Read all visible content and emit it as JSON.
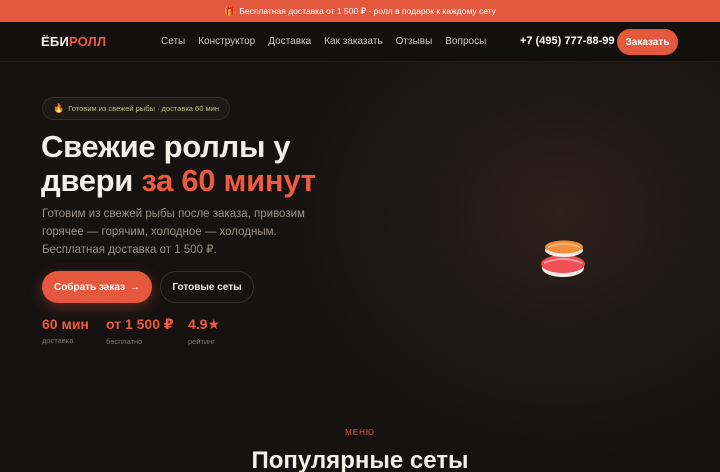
{
  "promo": {
    "icon": "gift-icon",
    "text": "Бесплатная доставка от 1 500 ₽ · ролл в подарок к каждому сету"
  },
  "header": {
    "logo_part1": "ЁБИ",
    "logo_part2": "РОЛЛ",
    "nav": [
      "Сеты",
      "Конструктор",
      "Доставка",
      "Как заказать",
      "Отзывы",
      "Вопросы"
    ],
    "phone": "+7 (495) 777-88-99",
    "order_label": "Заказать"
  },
  "hero": {
    "badge_icon": "fire-icon",
    "badge_text": "Готовим из свежей рыбы · доставка 60 мин",
    "title_line1": "Свежие роллы у",
    "title_line2_plain": "двери ",
    "title_line2_accent": "за 60 минут",
    "description": "Готовим из свежей рыбы после заказа, привозим горячее — горячим, холодное — холодным. Бесплатная доставка от 1 500 ₽.",
    "primary_button": "Собрать заказ",
    "primary_button_arrow": "→",
    "secondary_button": "Готовые сеты",
    "stats": [
      {
        "value": "60 мин",
        "label": "доставка"
      },
      {
        "value": "от 1 500 ₽",
        "label": "бесплатно"
      },
      {
        "value": "4.9★",
        "label": "рейтинг"
      }
    ],
    "image_icon": "sushi-icon"
  },
  "menu_section": {
    "label": "МЕНЮ",
    "title": "Популярные сеты"
  },
  "colors": {
    "accent": "#e4583d",
    "background": "#161211"
  }
}
